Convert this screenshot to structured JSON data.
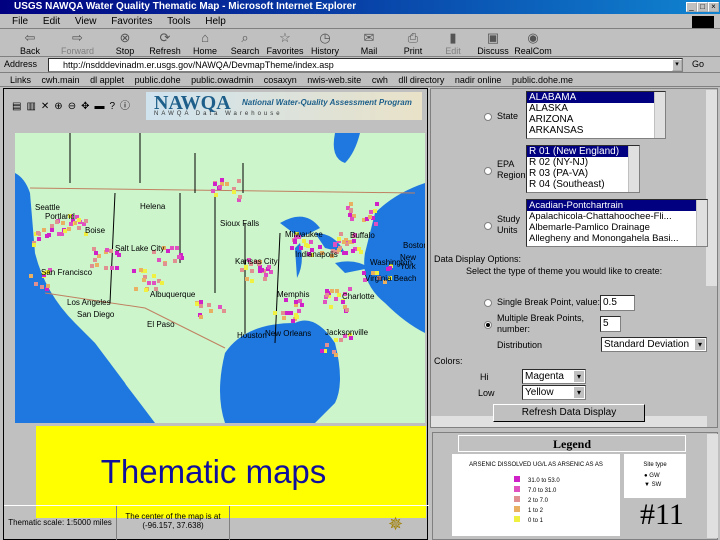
{
  "window": {
    "title": "USGS NAWQA Water Quality Thematic Map - Microsoft Internet Explorer"
  },
  "menu": [
    "File",
    "Edit",
    "View",
    "Favorites",
    "Tools",
    "Help"
  ],
  "toolbar": [
    {
      "label": "Back",
      "icon": "back-arrow-icon"
    },
    {
      "label": "Forward",
      "icon": "forward-arrow-icon"
    },
    {
      "label": "Stop",
      "icon": "stop-icon"
    },
    {
      "label": "Refresh",
      "icon": "refresh-icon"
    },
    {
      "label": "Home",
      "icon": "home-icon"
    },
    {
      "label": "Search",
      "icon": "search-icon"
    },
    {
      "label": "Favorites",
      "icon": "favorites-icon"
    },
    {
      "label": "History",
      "icon": "history-icon"
    },
    {
      "label": "Mail",
      "icon": "mail-icon"
    },
    {
      "label": "Print",
      "icon": "print-icon"
    },
    {
      "label": "Edit",
      "icon": "edit-icon"
    },
    {
      "label": "Discuss",
      "icon": "discuss-icon"
    },
    {
      "label": "RealCom",
      "icon": "realcom-icon"
    }
  ],
  "address": {
    "label": "Address",
    "value": "http://nsdddevinadm.er.usgs.gov/NAWQA/DevmapTheme/index.asp",
    "go": "Go"
  },
  "links": {
    "label": "Links",
    "items": [
      "cwh.main",
      "dl applet",
      "public.dohe",
      "public.owadmin",
      "cosaxyn",
      "nwis-web.site",
      "cwh",
      "dll directory",
      "nadir online",
      "public.dohe.me"
    ]
  },
  "banner": {
    "name": "NAWQA",
    "program": "National Water-Quality Assessment Program",
    "sub": "NAWQA Data Warehouse"
  },
  "map": {
    "cities": [
      "Seattle",
      "Portland",
      "Helena",
      "Boise",
      "Salt Lake City",
      "San Francisco",
      "Los Angeles",
      "San Diego",
      "El Paso",
      "Albuquerque",
      "Sioux Falls",
      "Milwaukee",
      "Buffalo",
      "Boston",
      "New York",
      "Washington",
      "Virginia Beach",
      "Indianapolis",
      "Kansas City",
      "Memphis",
      "Charlotte",
      "Houston",
      "New Orleans",
      "Jacksonville"
    ]
  },
  "overlay": {
    "title": "Thematic maps"
  },
  "status": {
    "scale": "Thematic scale: 1:5000 miles",
    "center": "The center of the map is at",
    "coords": "(-96.157, 37.638)"
  },
  "query": {
    "state": {
      "label": "State",
      "options": [
        "ALABAMA",
        "ALASKA",
        "ARIZONA",
        "ARKANSAS"
      ]
    },
    "epa": {
      "label1": "EPA",
      "label2": "Region",
      "options": [
        "R 01 (New England)",
        "R 02 (NY-NJ)",
        "R 03 (PA-VA)",
        "R 04 (Southeast)"
      ]
    },
    "study": {
      "label1": "Study",
      "label2": "Units",
      "options": [
        "Acadian-Pontchartrain",
        "Apalachicola-Chattahoochee-Fli...",
        "Albemarle-Pamlico Drainage",
        "Allegheny and Monongahela Basi..."
      ]
    }
  },
  "display": {
    "heading": "Data Display Options:",
    "instruction": "Select the type of theme you would like to create:",
    "single_label": "Single Break Point, value:",
    "single_value": "0.5",
    "multi_label1": "Multiple Break Points,",
    "multi_label2": "number:",
    "multi_value": "5",
    "dist_label": "Distribution",
    "dist_value": "Standard Deviation",
    "colors_label": "Colors:",
    "hi_label": "Hi",
    "hi_value": "Magenta",
    "low_label": "Low",
    "low_value": "Yellow",
    "refresh": "Refresh Data Display"
  },
  "legend": {
    "title": "Legend",
    "param": "ARSENIC DISSOLVED UG/L AS ARSENIC AS AS",
    "items": [
      {
        "label": "31.0 to 53.0",
        "color": "#d020c8"
      },
      {
        "label": "7.0 to 31.0",
        "color": "#e050c0"
      },
      {
        "label": "2 to 7.0",
        "color": "#e09090"
      },
      {
        "label": "1 to 2",
        "color": "#e8b060"
      },
      {
        "label": "0 to 1",
        "color": "#f0f040"
      }
    ],
    "site_title": "Site type",
    "sites": [
      {
        "label": "GW"
      },
      {
        "label": "SW"
      }
    ]
  },
  "slide": {
    "number": "#11"
  }
}
